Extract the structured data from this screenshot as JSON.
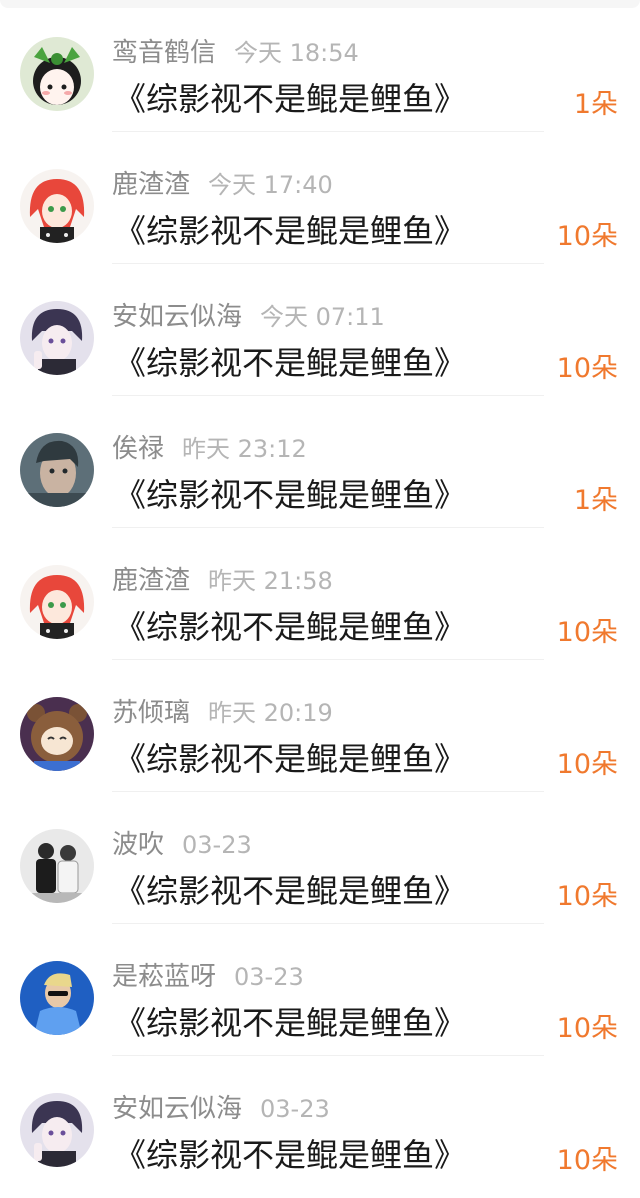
{
  "comments": [
    {
      "user": "鸾音鹤信",
      "time": "今天 18:54",
      "text": "《综影视不是鲲是鲤鱼》",
      "gift": "1朵",
      "avatar": "green-bow-girl-avatar"
    },
    {
      "user": "鹿渣渣",
      "time": "今天 17:40",
      "text": "《综影视不是鲲是鲤鱼》",
      "gift": "10朵",
      "avatar": "red-hair-anime-avatar"
    },
    {
      "user": "安如云似海",
      "time": "今天 07:11",
      "text": "《综影视不是鲲是鲤鱼》",
      "gift": "10朵",
      "avatar": "purple-hair-boy-avatar"
    },
    {
      "user": "俟禄",
      "time": "昨天 23:12",
      "text": "《综影视不是鲲是鲤鱼》",
      "gift": "1朵",
      "avatar": "photo-portrait-avatar"
    },
    {
      "user": "鹿渣渣",
      "time": "昨天 21:58",
      "text": "《综影视不是鲲是鲤鱼》",
      "gift": "10朵",
      "avatar": "red-hair-anime-avatar"
    },
    {
      "user": "苏倾璃",
      "time": "昨天 20:19",
      "text": "《综影视不是鲲是鲤鱼》",
      "gift": "10朵",
      "avatar": "bear-hood-avatar"
    },
    {
      "user": "波吹",
      "time": "03-23",
      "text": "《综影视不是鲲是鲤鱼》",
      "gift": "10朵",
      "avatar": "couple-photo-avatar"
    },
    {
      "user": "是菘蓝呀",
      "time": "03-23",
      "text": "《综影视不是鲲是鲤鱼》",
      "gift": "10朵",
      "avatar": "blue-photo-avatar"
    },
    {
      "user": "安如云似海",
      "time": "03-23",
      "text": "《综影视不是鲲是鲤鱼》",
      "gift": "10朵",
      "avatar": "purple-hair-boy-avatar"
    }
  ],
  "colors": {
    "gift": "#f0792e",
    "username": "#8c8c8c",
    "timestamp": "#b5b5b5",
    "text": "#1a1a1a"
  }
}
